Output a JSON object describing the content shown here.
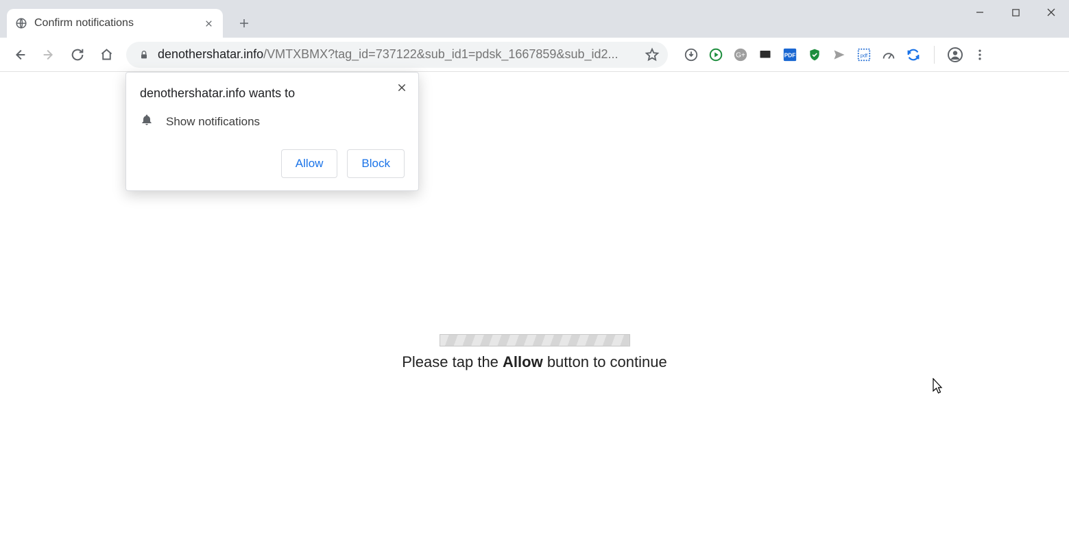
{
  "tab": {
    "title": "Confirm notifications"
  },
  "toolbar": {
    "url_host": "denothershatar.info",
    "url_path": "/VMTXBMX?tag_id=737122&sub_id1=pdsk_1667859&sub_id2..."
  },
  "prompt": {
    "title": "denothershatar.info wants to",
    "item": "Show notifications",
    "allow": "Allow",
    "block": "Block"
  },
  "page": {
    "msg_pre": "Please tap the ",
    "msg_bold": "Allow",
    "msg_post": " button to continue"
  }
}
